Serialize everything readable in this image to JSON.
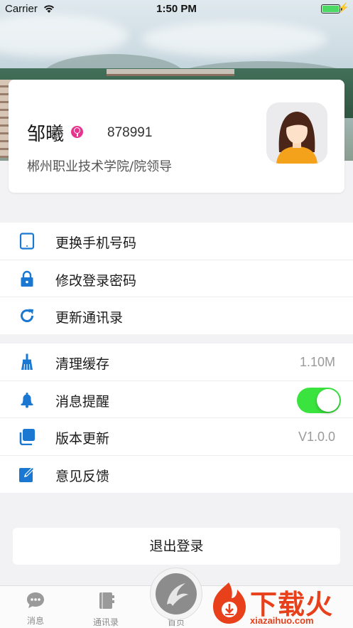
{
  "status_bar": {
    "carrier": "Carrier",
    "time": "1:50 PM",
    "battery_level": 1.0
  },
  "profile": {
    "name": "邹曦",
    "gender_icon": "female-icon",
    "user_id": "878991",
    "organization": "郴州职业技术学院/院领导"
  },
  "account_menu": [
    {
      "label": "更换手机号码",
      "icon": "phone-icon"
    },
    {
      "label": "修改登录密码",
      "icon": "lock-icon"
    },
    {
      "label": "更新通讯录",
      "icon": "refresh-icon"
    }
  ],
  "settings_menu": {
    "clear_cache": {
      "label": "清理缓存",
      "value": "1.10M",
      "icon": "broom-icon"
    },
    "notifications": {
      "label": "消息提醒",
      "enabled": true,
      "icon": "bell-icon"
    },
    "version": {
      "label": "版本更新",
      "value": "V1.0.0",
      "icon": "copy-icon"
    },
    "feedback": {
      "label": "意见反馈",
      "icon": "edit-icon"
    }
  },
  "logout_label": "退出登录",
  "tab_bar": {
    "messages": "消息",
    "contacts": "通讯录",
    "home": "首页"
  },
  "watermark": {
    "title": "下载火",
    "url": "xiazaihuo.com"
  },
  "colors": {
    "accent": "#1a78d2",
    "toggle_on": "#3be33f",
    "watermark": "#e8401a",
    "female": "#e8348f"
  }
}
